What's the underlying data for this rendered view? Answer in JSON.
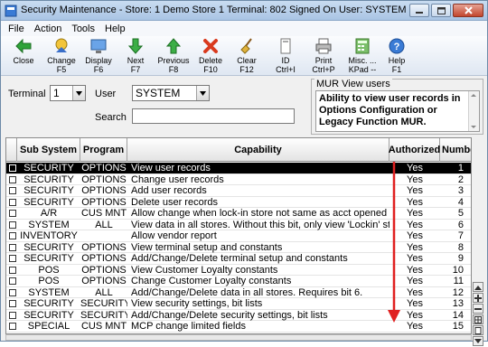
{
  "window": {
    "title": "Security Maintenance  - Store: 1  Demo Store 1  Terminal: 802  Signed On User: SYSTEM"
  },
  "menu": [
    "File",
    "Action",
    "Tools",
    "Help"
  ],
  "toolbar": [
    {
      "label": "Close",
      "key": "",
      "icon": "close-arrow-icon"
    },
    {
      "label": "Change",
      "key": "F5",
      "icon": "change-icon"
    },
    {
      "label": "Display",
      "key": "F6",
      "icon": "display-icon"
    },
    {
      "label": "Next",
      "key": "F7",
      "icon": "next-arrow-icon"
    },
    {
      "label": "Previous",
      "key": "F8",
      "icon": "previous-arrow-icon"
    },
    {
      "label": "Delete",
      "key": "F10",
      "icon": "delete-x-icon"
    },
    {
      "label": "Clear",
      "key": "F12",
      "icon": "broom-icon"
    },
    {
      "label": "ID",
      "key": "Ctrl+I",
      "icon": "id-card-icon"
    },
    {
      "label": "Print",
      "key": "Ctrl+P",
      "icon": "printer-icon"
    },
    {
      "label": "Misc. ...",
      "key": "KPad --",
      "icon": "calculator-icon"
    },
    {
      "label": "Help",
      "key": "F1",
      "icon": "help-icon"
    }
  ],
  "filters": {
    "terminal_label": "Terminal",
    "terminal_value": "1",
    "user_label": "User",
    "user_value": "SYSTEM",
    "search_label": "Search",
    "search_value": ""
  },
  "mur": {
    "legend": "MUR View users",
    "text": "Ability to view user records in Options Configuration or Legacy Function MUR."
  },
  "grid": {
    "columns": [
      "Sub System",
      "Program",
      "Capability",
      "Authorized",
      "Number"
    ],
    "rows": [
      {
        "sub": "SECURITY",
        "program": "OPTIONS",
        "capability": "View user records",
        "authorized": "Yes",
        "number": "1"
      },
      {
        "sub": "SECURITY",
        "program": "OPTIONS",
        "capability": "Change user records",
        "authorized": "Yes",
        "number": "2"
      },
      {
        "sub": "SECURITY",
        "program": "OPTIONS",
        "capability": "Add user records",
        "authorized": "Yes",
        "number": "3"
      },
      {
        "sub": "SECURITY",
        "program": "OPTIONS",
        "capability": "Delete user records",
        "authorized": "Yes",
        "number": "4"
      },
      {
        "sub": "A/R",
        "program": "CUS MNT",
        "capability": "Allow change when lock-in store not same as acct opened store",
        "authorized": "Yes",
        "number": "5"
      },
      {
        "sub": "SYSTEM",
        "program": "ALL",
        "capability": "View data in all stores. Without this bit, only view 'Lockin' store da",
        "authorized": "Yes",
        "number": "6"
      },
      {
        "sub": "INVENTORY",
        "program": "",
        "capability": "Allow vendor report",
        "authorized": "Yes",
        "number": "7"
      },
      {
        "sub": "SECURITY",
        "program": "OPTIONS",
        "capability": "View terminal setup and constants",
        "authorized": "Yes",
        "number": "8"
      },
      {
        "sub": "SECURITY",
        "program": "OPTIONS",
        "capability": "Add/Change/Delete terminal setup and constants",
        "authorized": "Yes",
        "number": "9"
      },
      {
        "sub": "POS",
        "program": "OPTIONS",
        "capability": "View Customer Loyalty constants",
        "authorized": "Yes",
        "number": "10"
      },
      {
        "sub": "POS",
        "program": "OPTIONS",
        "capability": "Change Customer Loyalty constants",
        "authorized": "Yes",
        "number": "11"
      },
      {
        "sub": "SYSTEM",
        "program": "ALL",
        "capability": "Add/Change/Delete data in all stores. Requires bit 6.",
        "authorized": "Yes",
        "number": "12"
      },
      {
        "sub": "SECURITY",
        "program": "SECURITY",
        "capability": "View security settings, bit lists",
        "authorized": "Yes",
        "number": "13"
      },
      {
        "sub": "SECURITY",
        "program": "SECURITY",
        "capability": "Add/Change/Delete security settings, bit lists",
        "authorized": "Yes",
        "number": "14"
      },
      {
        "sub": "SPECIAL",
        "program": "CUS MNT",
        "capability": "MCP change limited fields",
        "authorized": "Yes",
        "number": "15"
      }
    ]
  },
  "colors": {
    "selected_row_bg": "#000000",
    "annotation_arrow": "#e02020"
  }
}
